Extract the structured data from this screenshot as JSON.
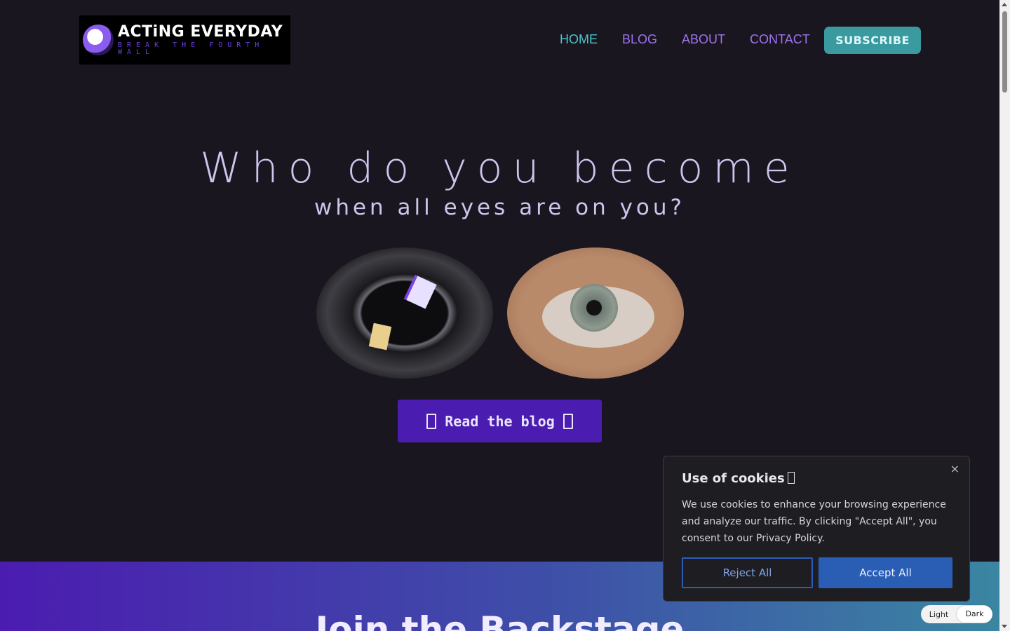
{
  "header": {
    "logo_title": "ACTiNG EVERYDAY",
    "logo_tagline": "BREAK THE FOURTH WALL",
    "nav": [
      {
        "label": "HOME",
        "active": true
      },
      {
        "label": "BLOG",
        "active": false
      },
      {
        "label": "ABOUT",
        "active": false
      },
      {
        "label": "CONTACT",
        "active": false
      }
    ],
    "subscribe_label": "SUBSCRIBE"
  },
  "hero": {
    "title": "Who do you become",
    "subtitle": "when all eyes are on you?",
    "images": [
      "camera-lens",
      "human-eye"
    ],
    "cta_label": "Read the blog"
  },
  "band": {
    "title": "Join the Backstage"
  },
  "cookie": {
    "title": "Use of cookies",
    "text": "We use cookies to enhance your browsing experience and analyze our traffic. By clicking \"Accept All\", you consent to our Privacy Policy.",
    "close": "×",
    "reject_label": "Reject All",
    "accept_label": "Accept All"
  },
  "theme_toggle": {
    "light": "Light",
    "dark": "Dark",
    "selected": "Dark"
  },
  "colors": {
    "background": "#19161f",
    "nav_active": "#4fc5c8",
    "nav_link": "#9e74f0",
    "cta": "#4a1db0",
    "accept": "#2a5db4"
  }
}
